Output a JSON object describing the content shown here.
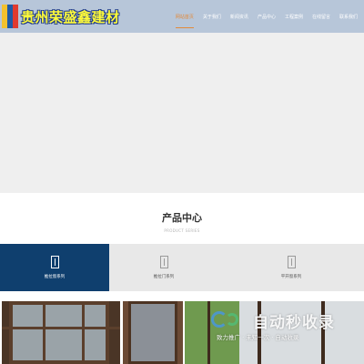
{
  "header": {
    "logo_text": "贵州荣盛鑫建材",
    "nav": [
      {
        "label": "网站首页",
        "active": true
      },
      {
        "label": "关于我们",
        "active": false
      },
      {
        "label": "新闻资讯",
        "active": false
      },
      {
        "label": "产品中心",
        "active": false
      },
      {
        "label": "工程案例",
        "active": false
      },
      {
        "label": "在线留言",
        "active": false
      },
      {
        "label": "联系我们",
        "active": false
      }
    ]
  },
  "section": {
    "title": "产品中心",
    "subtitle": "PRODUCT SERIES"
  },
  "series": [
    {
      "label": "推拉窗系列",
      "active": true
    },
    {
      "label": "推拉门系列",
      "active": false
    },
    {
      "label": "平开窗系列",
      "active": false
    }
  ],
  "watermark": {
    "title": "自动秒收录",
    "subtitle": "致力推广 · 未知一次 · 自动收录"
  },
  "colors": {
    "header_bg": "#b7c6d9",
    "nav_active": "#e38a3a",
    "series_active_bg": "#0f3f6e"
  }
}
